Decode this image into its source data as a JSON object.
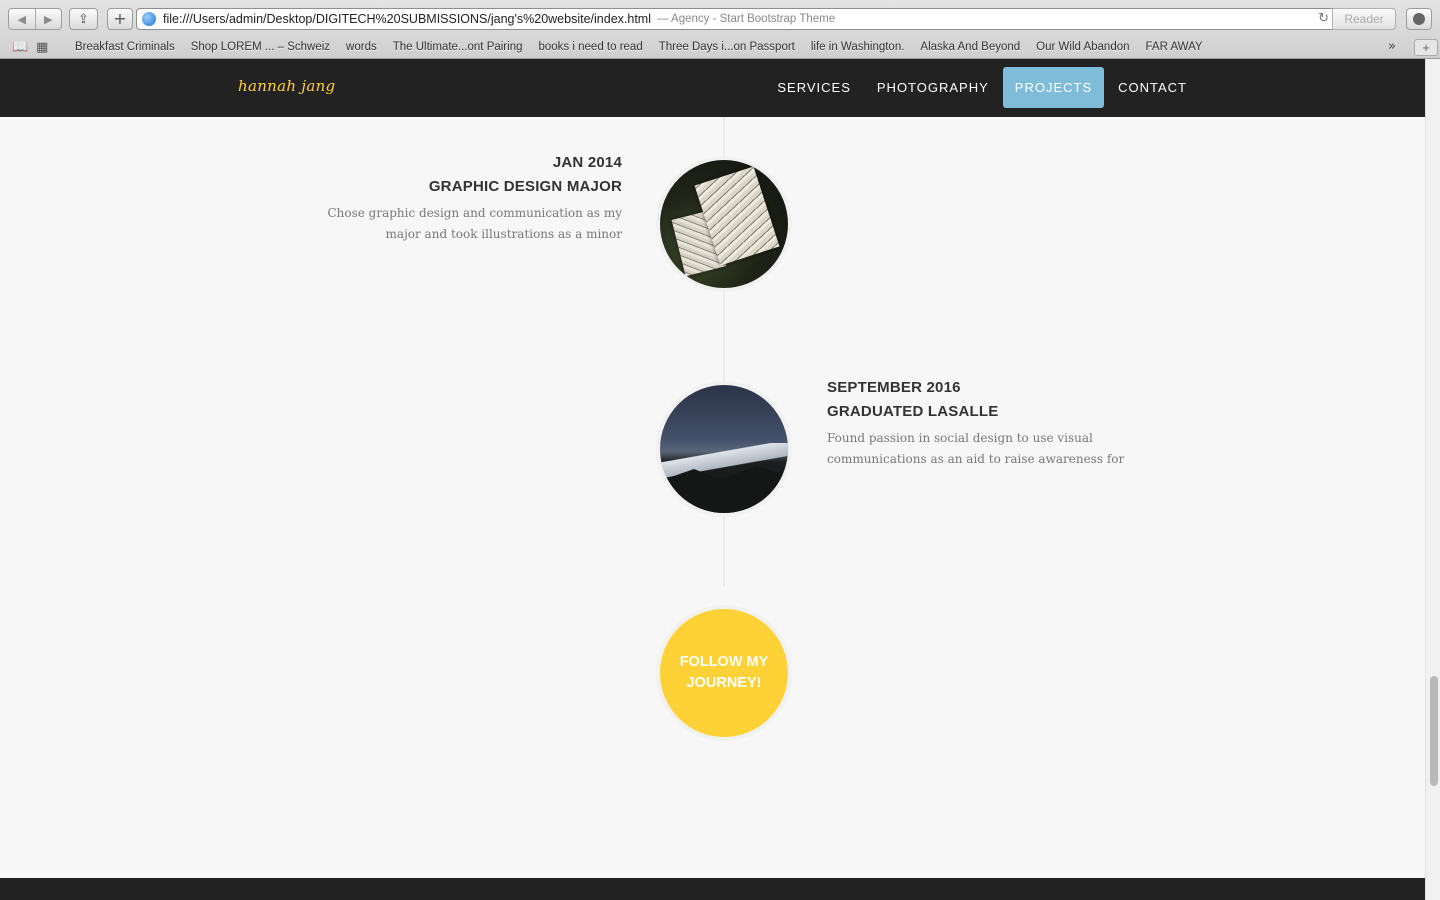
{
  "browser": {
    "url": "file:///Users/admin/Desktop/DIGITECH%20SUBMISSIONS/jang's%20website/index.html",
    "page_title": "— Agency - Start Bootstrap Theme",
    "reader_label": "Reader",
    "bookmarks": [
      "Breakfast Criminals",
      "Shop LOREM ... – Schweiz",
      "words",
      "The Ultimate...ont Pairing",
      "books i need to read",
      "Three Days i...on Passport",
      "life in Washington.",
      "Alaska And Beyond",
      "Our Wild Abandon",
      "FAR AWAY"
    ]
  },
  "site": {
    "brand": "hannah jang",
    "nav": [
      "SERVICES",
      "PHOTOGRAPHY",
      "PROJECTS",
      "CONTACT"
    ],
    "active_nav": "PROJECTS",
    "accent_color": "#fed136",
    "active_nav_color": "#7fbcd9"
  },
  "timeline": [
    {
      "date": "JAN 2014",
      "title": "GRAPHIC DESIGN MAJOR",
      "description": "Chose graphic design and communication as my major and took illustrations as a minor",
      "side": "left",
      "image": "sketchbook-photo"
    },
    {
      "date": "SEPTEMBER 2016",
      "title": "GRADUATED LASALLE",
      "description": "Found passion in social design to use visual communications as an aid to raise awareness for",
      "side": "right",
      "image": "mountain-photo"
    }
  ],
  "follow": {
    "label": "FOLLOW MY JOURNEY!"
  }
}
